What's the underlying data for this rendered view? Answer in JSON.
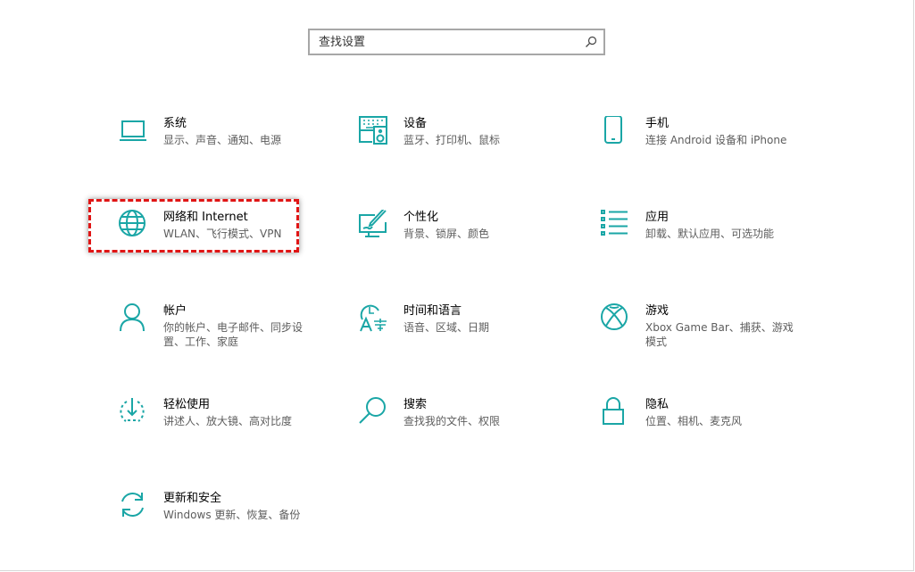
{
  "search": {
    "placeholder": "查找设置"
  },
  "accent_color": "#1aa6a6",
  "highlight_color": "#e01515",
  "tiles": [
    {
      "icon": "laptop-icon",
      "title": "系统",
      "subtitle": "显示、声音、通知、电源"
    },
    {
      "icon": "keyboard-speaker-icon",
      "title": "设备",
      "subtitle": "蓝牙、打印机、鼠标"
    },
    {
      "icon": "phone-icon",
      "title": "手机",
      "subtitle": "连接 Android 设备和 iPhone"
    },
    {
      "icon": "globe-icon",
      "title": "网络和 Internet",
      "subtitle": "WLAN、飞行模式、VPN"
    },
    {
      "icon": "paint-brush-icon",
      "title": "个性化",
      "subtitle": "背景、锁屏、颜色"
    },
    {
      "icon": "app-list-icon",
      "title": "应用",
      "subtitle": "卸载、默认应用、可选功能"
    },
    {
      "icon": "person-icon",
      "title": "帐户",
      "subtitle": "你的帐户、电子邮件、同步设置、工作、家庭"
    },
    {
      "icon": "time-language-icon",
      "title": "时间和语言",
      "subtitle": "语音、区域、日期"
    },
    {
      "icon": "xbox-icon",
      "title": "游戏",
      "subtitle": "Xbox Game Bar、捕获、游戏模式"
    },
    {
      "icon": "ease-of-access-icon",
      "title": "轻松使用",
      "subtitle": "讲述人、放大镜、高对比度"
    },
    {
      "icon": "magnifier-icon",
      "title": "搜索",
      "subtitle": "查找我的文件、权限"
    },
    {
      "icon": "lock-icon",
      "title": "隐私",
      "subtitle": "位置、相机、麦克风"
    },
    {
      "icon": "sync-icon",
      "title": "更新和安全",
      "subtitle": "Windows 更新、恢复、备份"
    }
  ]
}
